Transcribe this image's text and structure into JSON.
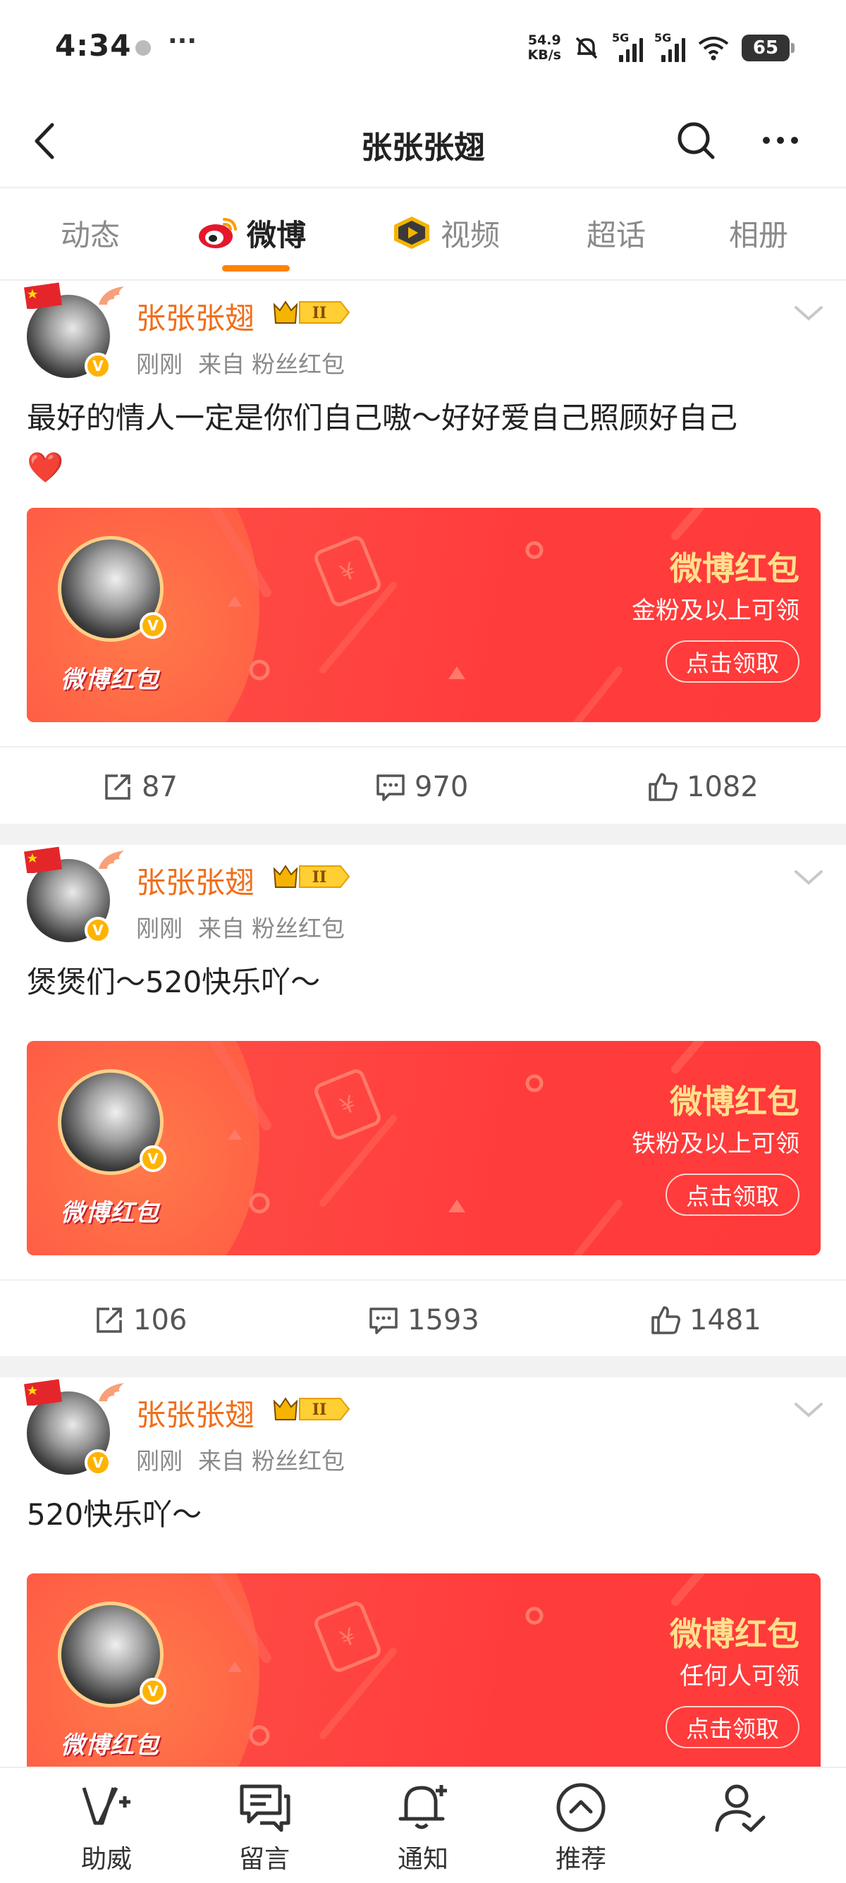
{
  "status_bar": {
    "time": "4:34",
    "more": "···",
    "net_speed_value": "54.9",
    "net_speed_unit": "KB/s",
    "sim1": "5G",
    "sim2": "5G",
    "battery": "65"
  },
  "nav": {
    "title": "张张张翅"
  },
  "tabs": [
    {
      "label": "动态"
    },
    {
      "label": "微博"
    },
    {
      "label": "视频"
    },
    {
      "label": "超话"
    },
    {
      "label": "相册"
    }
  ],
  "tab_active": "微博",
  "level_badge": "II",
  "posts": [
    {
      "author": "张张张翅",
      "time": "刚刚",
      "source_prefix": "来自",
      "source": "粉丝红包",
      "text": "最好的情人一定是你们自己嗷～好好爱自己照顾好自己",
      "emoji": "❤️",
      "card": {
        "brand": "微博红包",
        "title": "微博红包",
        "condition": "金粉及以上可领",
        "button": "点击领取"
      },
      "reposts": "87",
      "comments": "970",
      "likes": "1082"
    },
    {
      "author": "张张张翅",
      "time": "刚刚",
      "source_prefix": "来自",
      "source": "粉丝红包",
      "text": "煲煲们～520快乐吖～",
      "card": {
        "brand": "微博红包",
        "title": "微博红包",
        "condition": "铁粉及以上可领",
        "button": "点击领取"
      },
      "reposts": "106",
      "comments": "1593",
      "likes": "1481"
    },
    {
      "author": "张张张翅",
      "time": "刚刚",
      "source_prefix": "来自",
      "source": "粉丝红包",
      "text": "520快乐吖～",
      "card": {
        "brand": "微博红包",
        "title": "微博红包",
        "condition": "任何人可领",
        "button": "点击领取"
      }
    }
  ],
  "toolbar": [
    {
      "label": "助威",
      "icon": "boost-icon"
    },
    {
      "label": "留言",
      "icon": "message-icon"
    },
    {
      "label": "通知",
      "icon": "bell-plus-icon"
    },
    {
      "label": "推荐",
      "icon": "chevron-up-circle-icon"
    },
    {
      "label": "",
      "icon": "user-check-icon"
    }
  ],
  "colors": {
    "accent": "#ff8200",
    "author_name": "#f06e19",
    "red_card": "#ff3c3c",
    "card_title": "#ffe08c"
  }
}
